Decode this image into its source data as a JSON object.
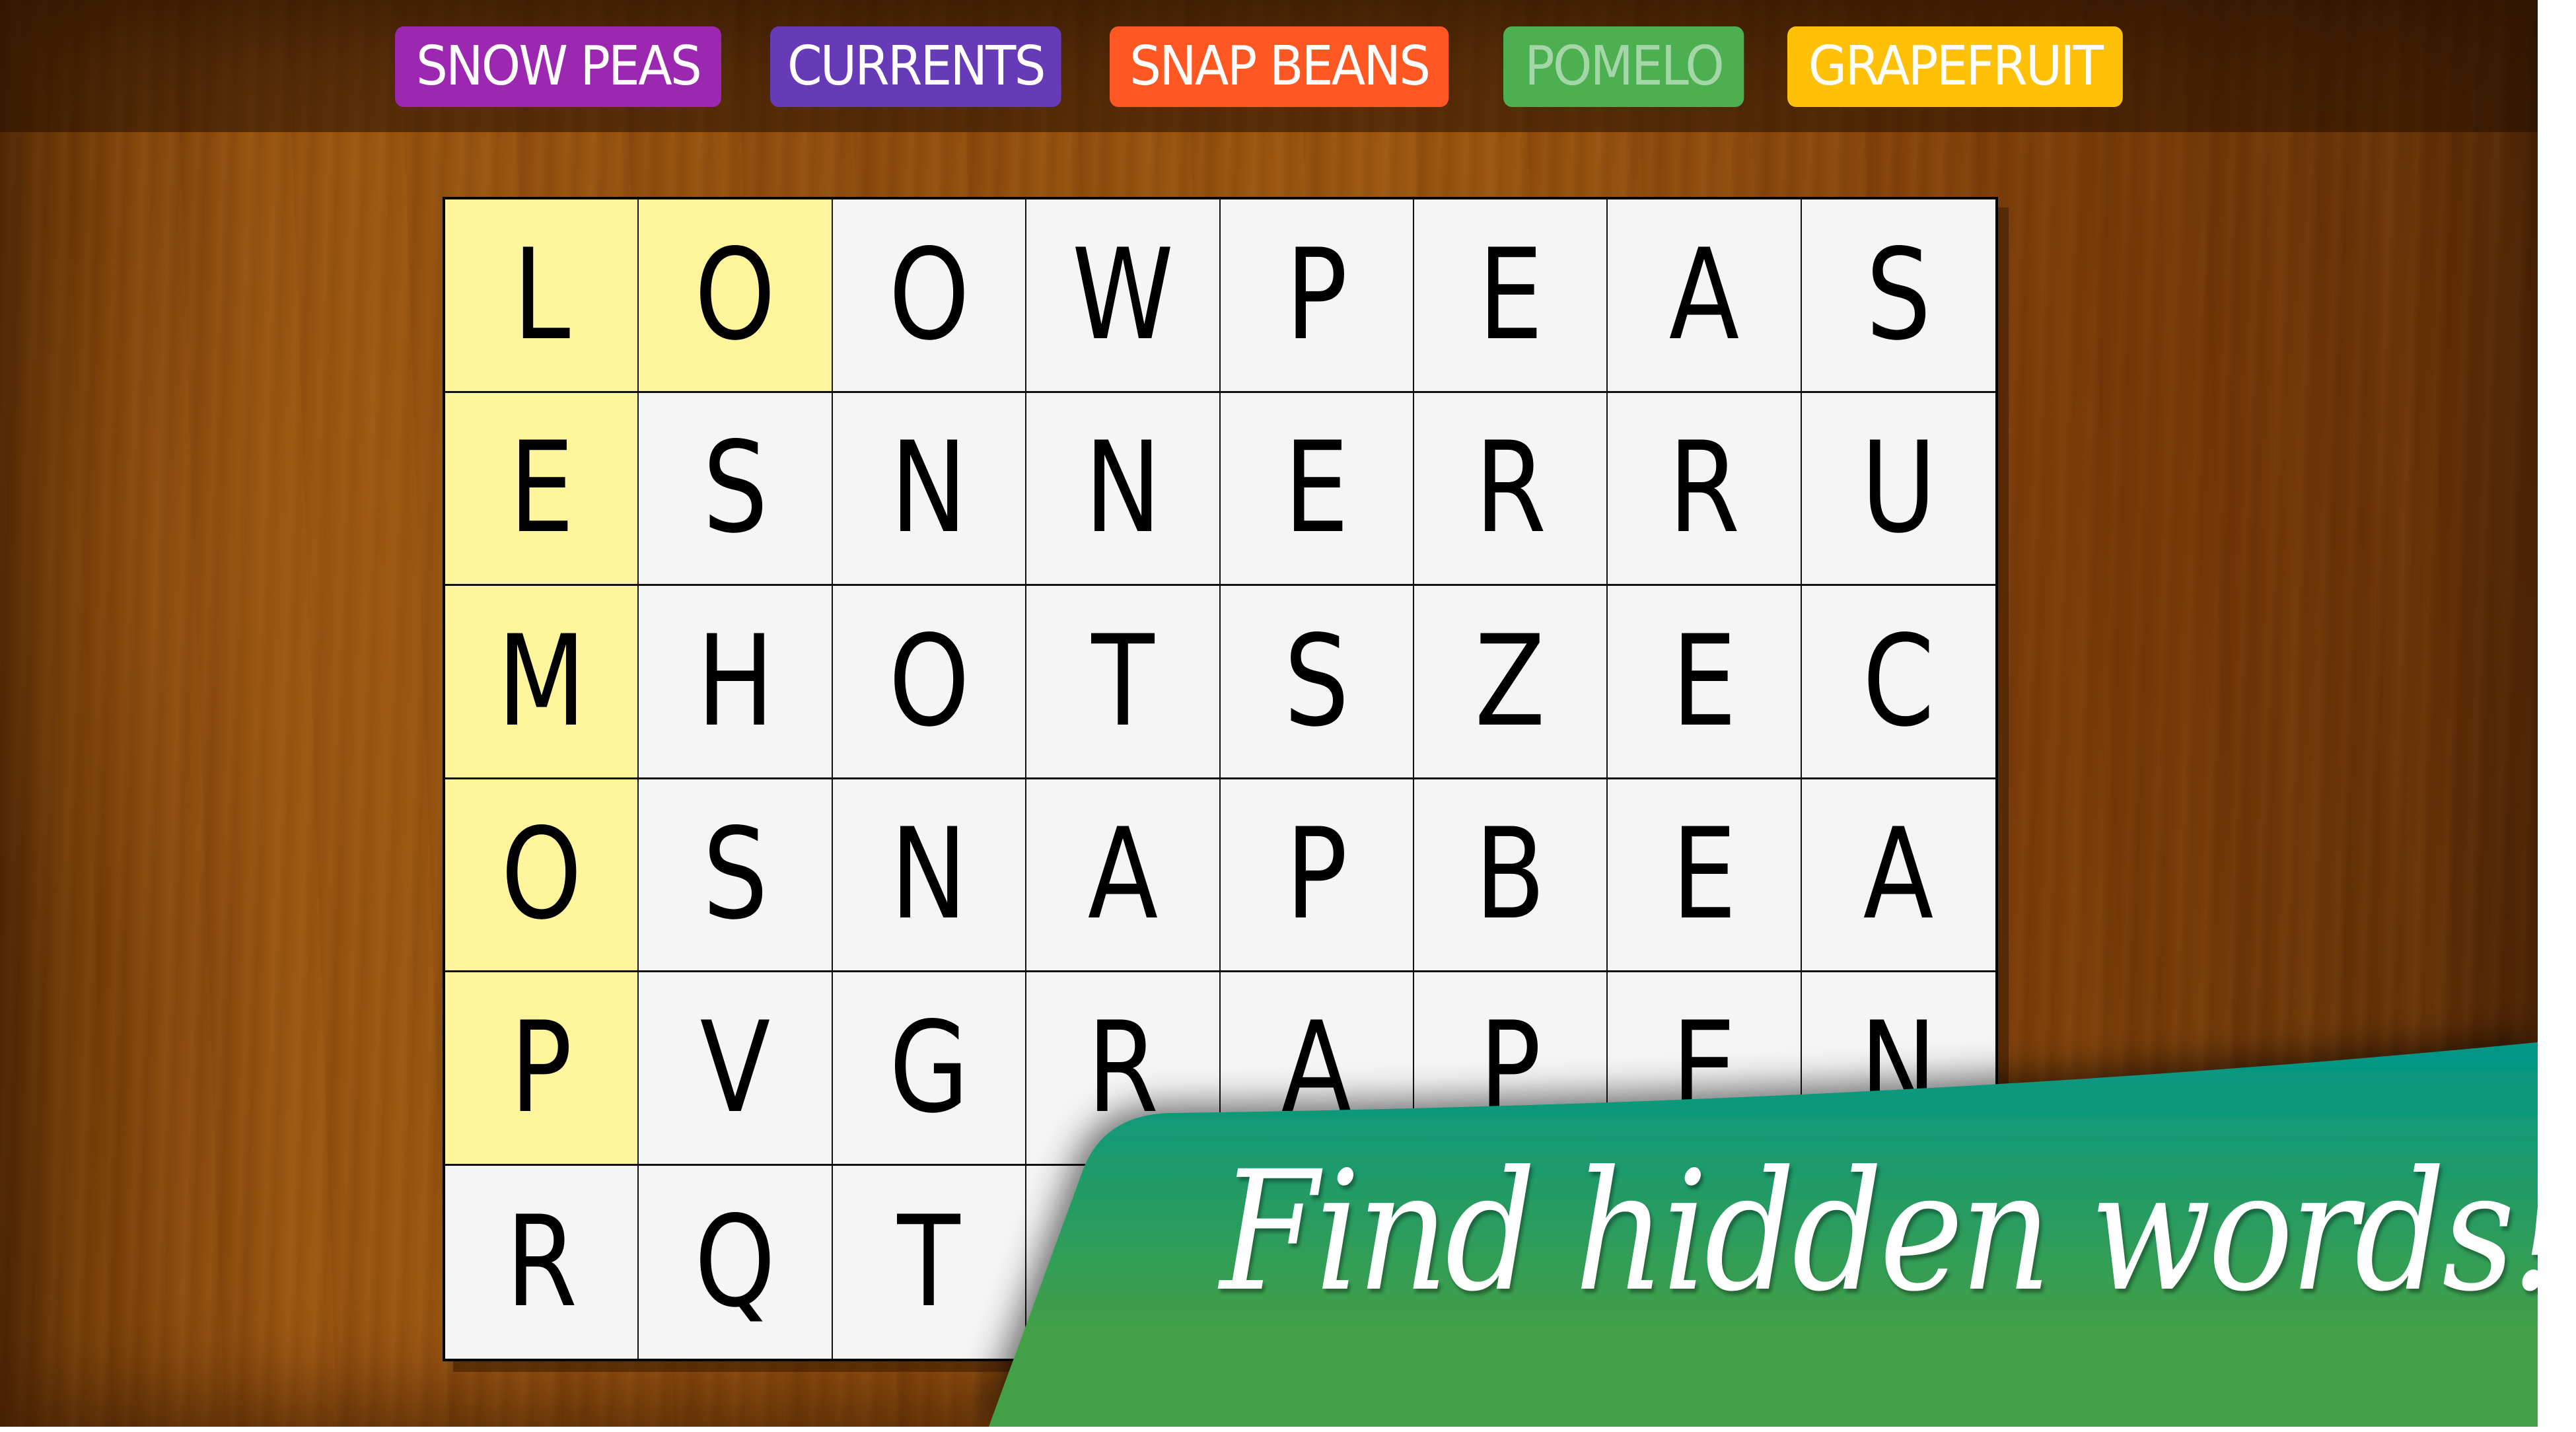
{
  "app": {
    "kind": "word search puzzle promotional screen"
  },
  "word_list": [
    {
      "label": "SNOW PEAS",
      "color": "#9C27B0",
      "found": false
    },
    {
      "label": "CURRENTS",
      "color": "#673AB7",
      "found": false
    },
    {
      "label": "SNAP BEANS",
      "color": "#FF5722",
      "found": false
    },
    {
      "label": "POMELO",
      "color": "#4CAF50",
      "found": true
    },
    {
      "label": "GRAPEFRUIT",
      "color": "#FFC107",
      "found": false
    }
  ],
  "grid": {
    "rows": 6,
    "cols": 8,
    "letters": [
      [
        "L",
        "O",
        "O",
        "W",
        "P",
        "E",
        "A",
        "S"
      ],
      [
        "E",
        "S",
        "N",
        "N",
        "E",
        "R",
        "R",
        "U"
      ],
      [
        "M",
        "H",
        "O",
        "T",
        "S",
        "Z",
        "E",
        "C"
      ],
      [
        "O",
        "S",
        "N",
        "A",
        "P",
        "B",
        "E",
        "A"
      ],
      [
        "P",
        "V",
        "G",
        "R",
        "A",
        "P",
        "E",
        "N"
      ],
      [
        "R",
        "Q",
        "T",
        "",
        "",
        "",
        "",
        ""
      ]
    ],
    "highlighted_cells": [
      [
        0,
        0
      ],
      [
        0,
        1
      ],
      [
        1,
        0
      ],
      [
        2,
        0
      ],
      [
        3,
        0
      ],
      [
        4,
        0
      ]
    ],
    "highlight_color": "#FFF59D",
    "cell_color": "#F5F5F5"
  },
  "banner": {
    "text": "Find hidden words!",
    "gradient_top": "#009688",
    "gradient_bottom": "#43A047"
  }
}
